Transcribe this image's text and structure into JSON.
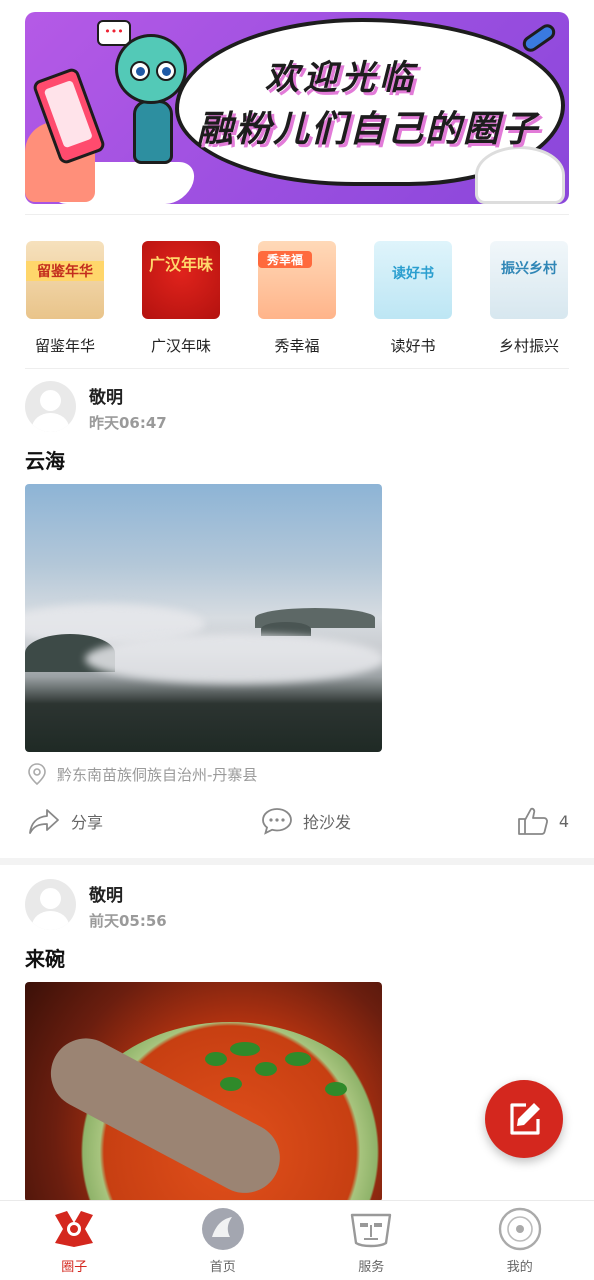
{
  "banner": {
    "line1": "欢迎光临",
    "line2": "融粉儿们自己的圈子"
  },
  "categories": [
    {
      "label": "留鉴年华",
      "thumb_text": "留鉴年华"
    },
    {
      "label": "广汉年味",
      "thumb_text": "广汉年味"
    },
    {
      "label": "秀幸福",
      "thumb_text": "秀幸福"
    },
    {
      "label": "读好书",
      "thumb_text": "读好书"
    },
    {
      "label": "乡村振兴",
      "thumb_text": "振兴乡村"
    }
  ],
  "posts": [
    {
      "author": "敬明",
      "time": "昨天06:47",
      "title": "云海",
      "location": "黔东南苗族侗族自治州-丹寨县",
      "share_label": "分享",
      "comment_label": "抢沙发",
      "like_count": "4"
    },
    {
      "author": "敬明",
      "time": "前天05:56",
      "title": "来碗"
    }
  ],
  "colors": {
    "accent": "#d4271e",
    "muted": "#9a9a9a"
  },
  "bottom_nav": [
    {
      "label": "圈子",
      "icon": "circle-logo-icon",
      "active": true
    },
    {
      "label": "首页",
      "icon": "home-emblem-icon",
      "active": false
    },
    {
      "label": "服务",
      "icon": "mask-icon",
      "active": false
    },
    {
      "label": "我的",
      "icon": "profile-disc-icon",
      "active": false
    }
  ]
}
